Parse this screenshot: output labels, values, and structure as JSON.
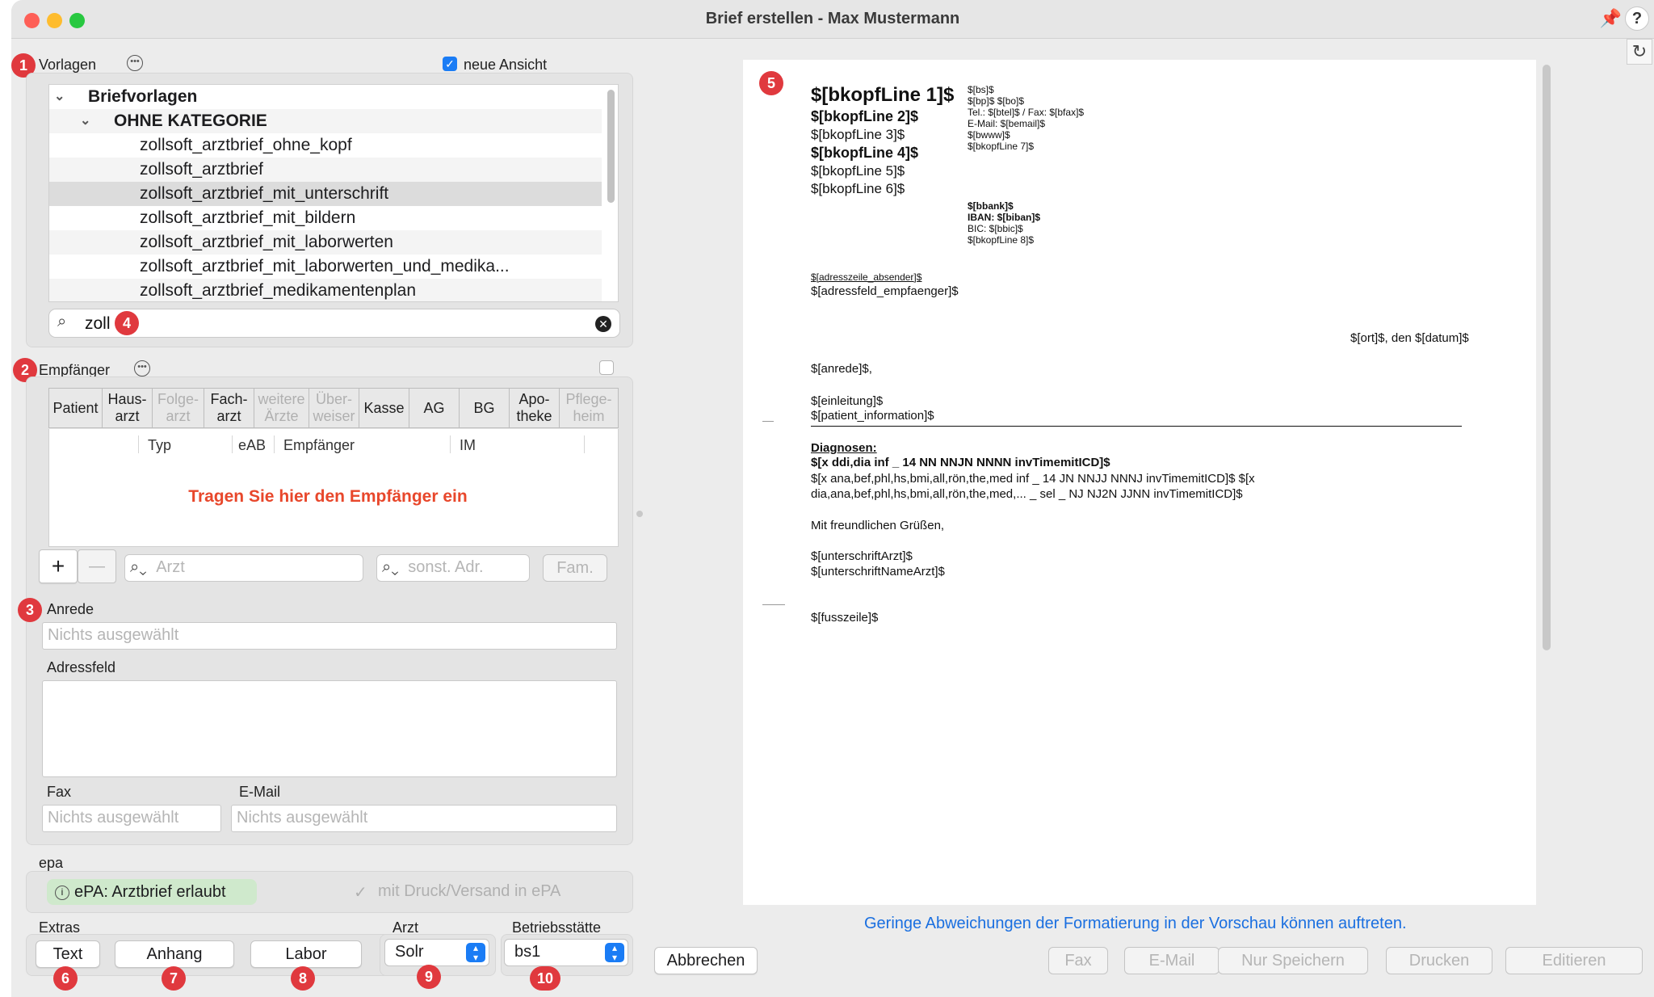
{
  "window": {
    "title": "Brief erstellen - Max Mustermann"
  },
  "vorlagen": {
    "label": "Vorlagen",
    "neue_ansicht_label": "neue Ansicht",
    "neue_ansicht_checked": true,
    "tree": {
      "root": "Briefvorlagen",
      "category": "OHNE KATEGORIE",
      "items": [
        "zollsoft_arztbrief_ohne_kopf",
        "zollsoft_arztbrief",
        "zollsoft_arztbrief_mit_unterschrift",
        "zollsoft_arztbrief_mit_bildern",
        "zollsoft_arztbrief_mit_laborwerten",
        "zollsoft_arztbrief_mit_laborwerten_und_medika...",
        "zollsoft_arztbrief_medikamentenplan"
      ],
      "selected_index": 2
    },
    "search_value": "zoll"
  },
  "empfaenger": {
    "label": "Empfänger",
    "tabs": [
      {
        "label": "Patient",
        "enabled": true
      },
      {
        "label": "Haus-\narzt",
        "enabled": true
      },
      {
        "label": "Folge-\narzt",
        "enabled": false
      },
      {
        "label": "Fach-\narzt",
        "enabled": true
      },
      {
        "label": "weitere\nÄrzte",
        "enabled": false
      },
      {
        "label": "Über-\nweiser",
        "enabled": false
      },
      {
        "label": "Kasse",
        "enabled": true
      },
      {
        "label": "AG",
        "enabled": true
      },
      {
        "label": "BG",
        "enabled": true
      },
      {
        "label": "Apo-\ntheke",
        "enabled": true
      },
      {
        "label": "Pflege-\nheim",
        "enabled": false
      }
    ],
    "columns": [
      "Typ",
      "eAB",
      "Empfänger",
      "IM"
    ],
    "empty_hint": "Tragen Sie hier den Empfänger ein",
    "add_label": "+",
    "remove_label": "—",
    "arzt_placeholder": "Arzt",
    "sonst_placeholder": "sonst. Adr.",
    "fam_label": "Fam."
  },
  "anrede": {
    "label": "Anrede",
    "placeholder": "Nichts ausgewählt"
  },
  "adressfeld": {
    "label": "Adressfeld"
  },
  "fax": {
    "label": "Fax",
    "placeholder": "Nichts ausgewählt"
  },
  "email": {
    "label": "E-Mail",
    "placeholder": "Nichts ausgewählt"
  },
  "epa": {
    "label": "epa",
    "chip": "ePA: Arztbrief erlaubt",
    "checkbox_label": "mit Druck/Versand in ePA"
  },
  "extras": {
    "label": "Extras",
    "buttons": [
      "Text",
      "Anhang",
      "Labor"
    ]
  },
  "arzt": {
    "label": "Arzt",
    "value": "Solr"
  },
  "betriebsstaette": {
    "label": "Betriebsstätte",
    "value": "bs1"
  },
  "badges": [
    "1",
    "2",
    "3",
    "4",
    "5",
    "6",
    "7",
    "8",
    "9",
    "10"
  ],
  "preview": {
    "k1": "$[bkopfLine 1]$",
    "k2": "$[bkopfLine 2]$",
    "k3": "$[bkopfLine 3]$",
    "k4": "$[bkopfLine 4]$",
    "k5": "$[bkopfLine 5]$",
    "k6": "$[bkopfLine 6]$",
    "r1": "$[bs]$",
    "r2": "$[bp]$ $[bo]$",
    "r3": "Tel.: $[btel]$ / Fax: $[bfax]$",
    "r4": "E-Mail: $[bemail]$",
    "r5": "$[bwww]$",
    "r6": "$[bkopfLine 7]$",
    "bank1": "$[bbank]$",
    "bank2": "IBAN: $[biban]$",
    "bank3": "BIC: $[bbic]$",
    "bank4": "$[bkopfLine 8]$",
    "absender": "$[adresszeile_absender]$",
    "empfaenger": "$[adressfeld_empfaenger]$",
    "ort_datum": "$[ort]$, den $[datum]$",
    "anrede": "$[anrede]$,",
    "einleitung": "$[einleitung]$",
    "patient_info": "$[patient_information]$",
    "diagnosen_head": "Diagnosen:",
    "diag1": "$[x ddi,dia inf _ 14 NN NNJN NNNN invTimemitICD]$",
    "diag2": "$[x ana,bef,phl,hs,bmi,all,rön,the,med inf _ 14 JN NNJJ NNNJ invTimemitICD]$ $[x",
    "diag3": "dia,ana,bef,phl,hs,bmi,all,rön,the,med,... _ sel _ NJ NJ2N JJNN invTimemitICD]$",
    "gruss": "Mit freundlichen Grüßen,",
    "sign1": "$[unterschriftArzt]$",
    "sign2": "$[unterschriftNameArzt]$",
    "fusszeile": "$[fusszeile]$"
  },
  "note": "Geringe Abweichungen der Formatierung in der Vorschau können auftreten.",
  "actions": {
    "cancel": "Abbrechen",
    "fax": "Fax",
    "email": "E-Mail",
    "save": "Nur Speichern",
    "print": "Drucken",
    "edit": "Editieren"
  },
  "colors": {
    "accent": "#1a7cf5",
    "badge": "#e0393e",
    "hint_red": "#e8472b",
    "link_blue": "#1a6fe0"
  }
}
